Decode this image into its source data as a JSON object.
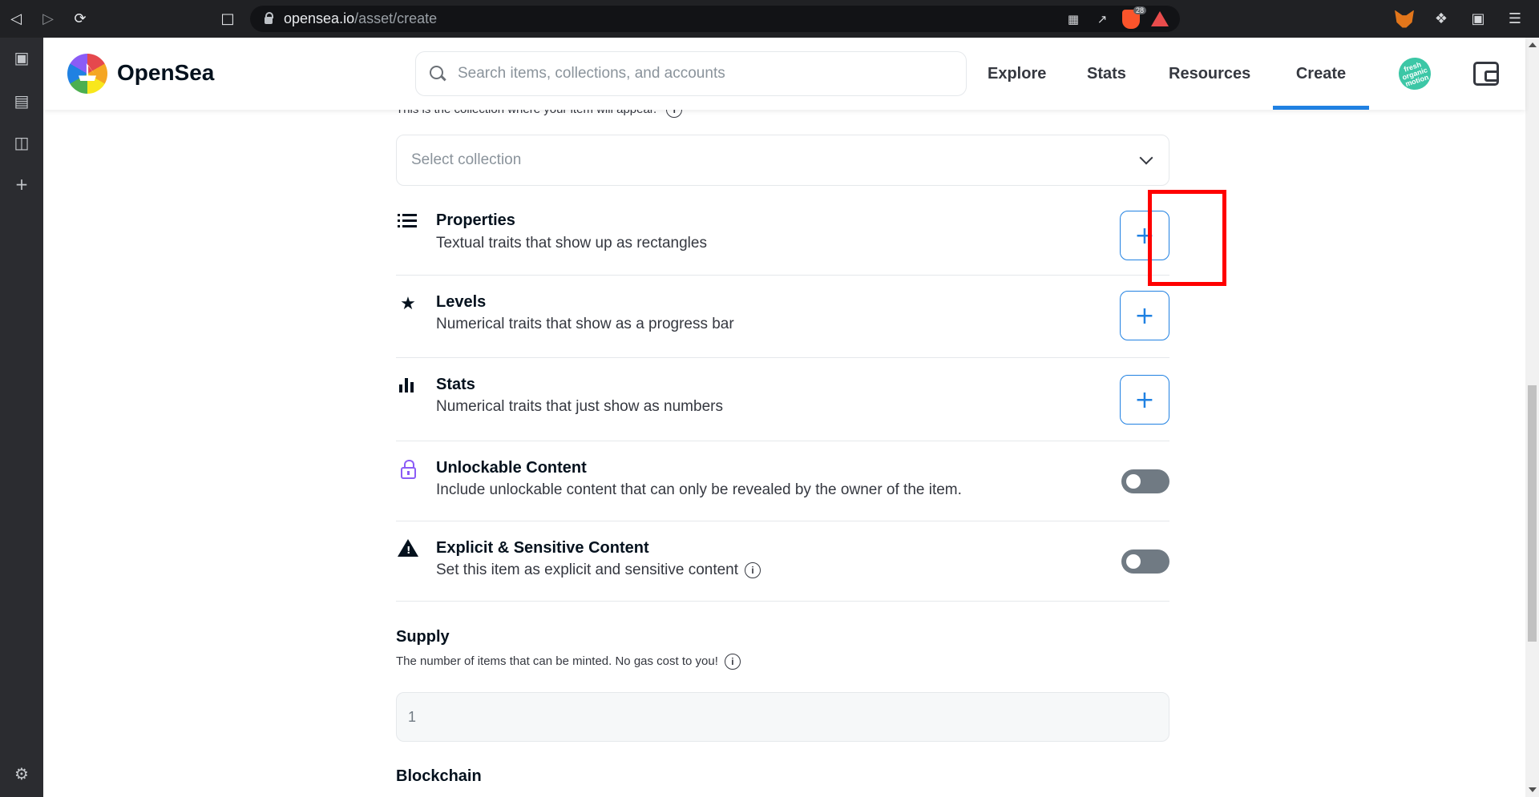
{
  "browser": {
    "url_host": "opensea.io",
    "url_path": "/asset/create",
    "brave_badge": "28"
  },
  "header": {
    "logo_text": "OpenSea",
    "search_placeholder": "Search items, collections, and accounts",
    "nav": [
      "Explore",
      "Stats",
      "Resources",
      "Create"
    ],
    "active_nav": "Create",
    "avatar_text": "fresh organic motion"
  },
  "form": {
    "collection_hint": "This is the collection where your item will appear.",
    "collection_select_placeholder": "Select collection",
    "traits": [
      {
        "icon": "list-icon",
        "title": "Properties",
        "description": "Textual traits that show up as rectangles",
        "control": "+"
      },
      {
        "icon": "star-icon",
        "title": "Levels",
        "description": "Numerical traits that show as a progress bar",
        "control": "+"
      },
      {
        "icon": "bar-chart-icon",
        "title": "Stats",
        "description": "Numerical traits that just show as numbers",
        "control": "+"
      }
    ],
    "toggles": [
      {
        "icon": "lock-icon",
        "title": "Unlockable Content",
        "description": "Include unlockable content that can only be revealed by the owner of the item.",
        "enabled": false
      },
      {
        "icon": "warning-icon",
        "title": "Explicit & Sensitive Content",
        "description": "Set this item as explicit and sensitive content",
        "enabled": false
      }
    ],
    "supply": {
      "title": "Supply",
      "hint": "The number of items that can be minted. No gas cost to you!",
      "value": "1"
    },
    "blockchain": {
      "title": "Blockchain"
    }
  },
  "colors": {
    "accent": "#2081e2",
    "highlight": "#ff0000",
    "lock": "#8b5cf6"
  }
}
